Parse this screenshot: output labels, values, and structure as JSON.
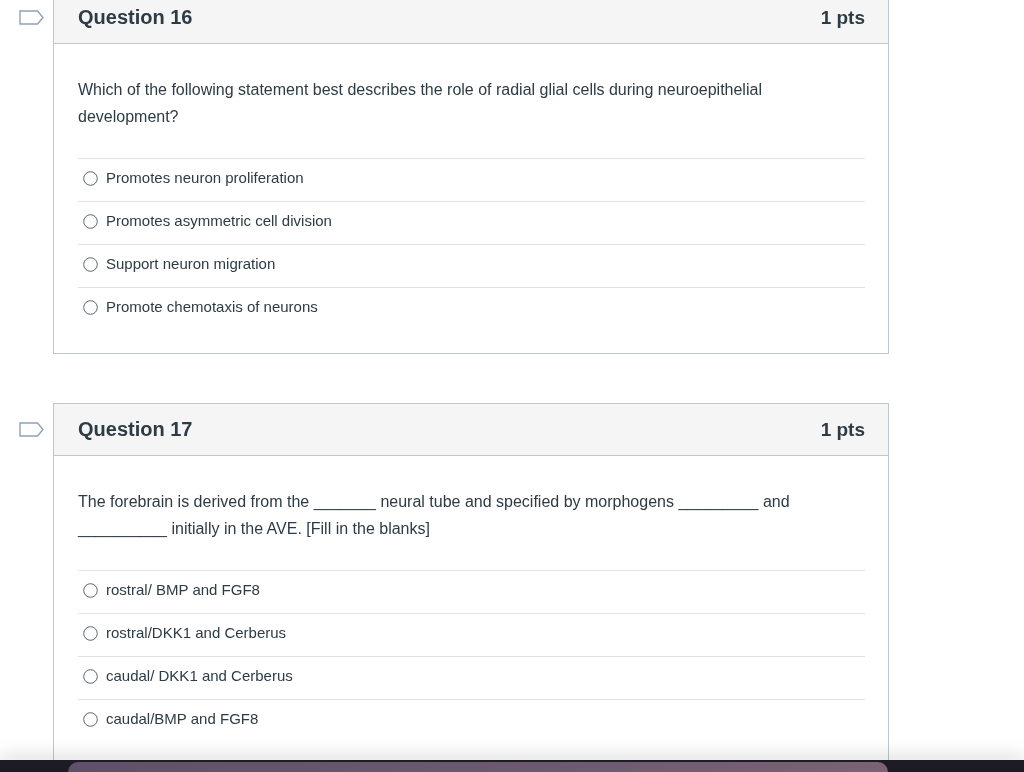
{
  "questions": [
    {
      "title": "Question 16",
      "points": "1 pts",
      "flagged": false,
      "text": "Which of the following statement best describes the role of radial glial cells during neuroepithelial development?",
      "answers": [
        {
          "label": "Promotes neuron proliferation",
          "selected": false
        },
        {
          "label": "Promotes asymmetric cell division",
          "selected": false
        },
        {
          "label": "Support neuron migration",
          "selected": false
        },
        {
          "label": "Promote chemotaxis of neurons",
          "selected": false
        }
      ]
    },
    {
      "title": "Question 17",
      "points": "1 pts",
      "flagged": false,
      "text": "The forebrain is derived from the _______ neural tube and specified by morphogens _________ and __________ initially in the AVE. [Fill in the blanks]",
      "answers": [
        {
          "label": "rostral/ BMP and FGF8",
          "selected": false
        },
        {
          "label": "rostral/DKK1 and Cerberus",
          "selected": false
        },
        {
          "label": "caudal/ DKK1 and Cerberus",
          "selected": false
        },
        {
          "label": "caudal/BMP and FGF8",
          "selected": false
        }
      ]
    }
  ]
}
